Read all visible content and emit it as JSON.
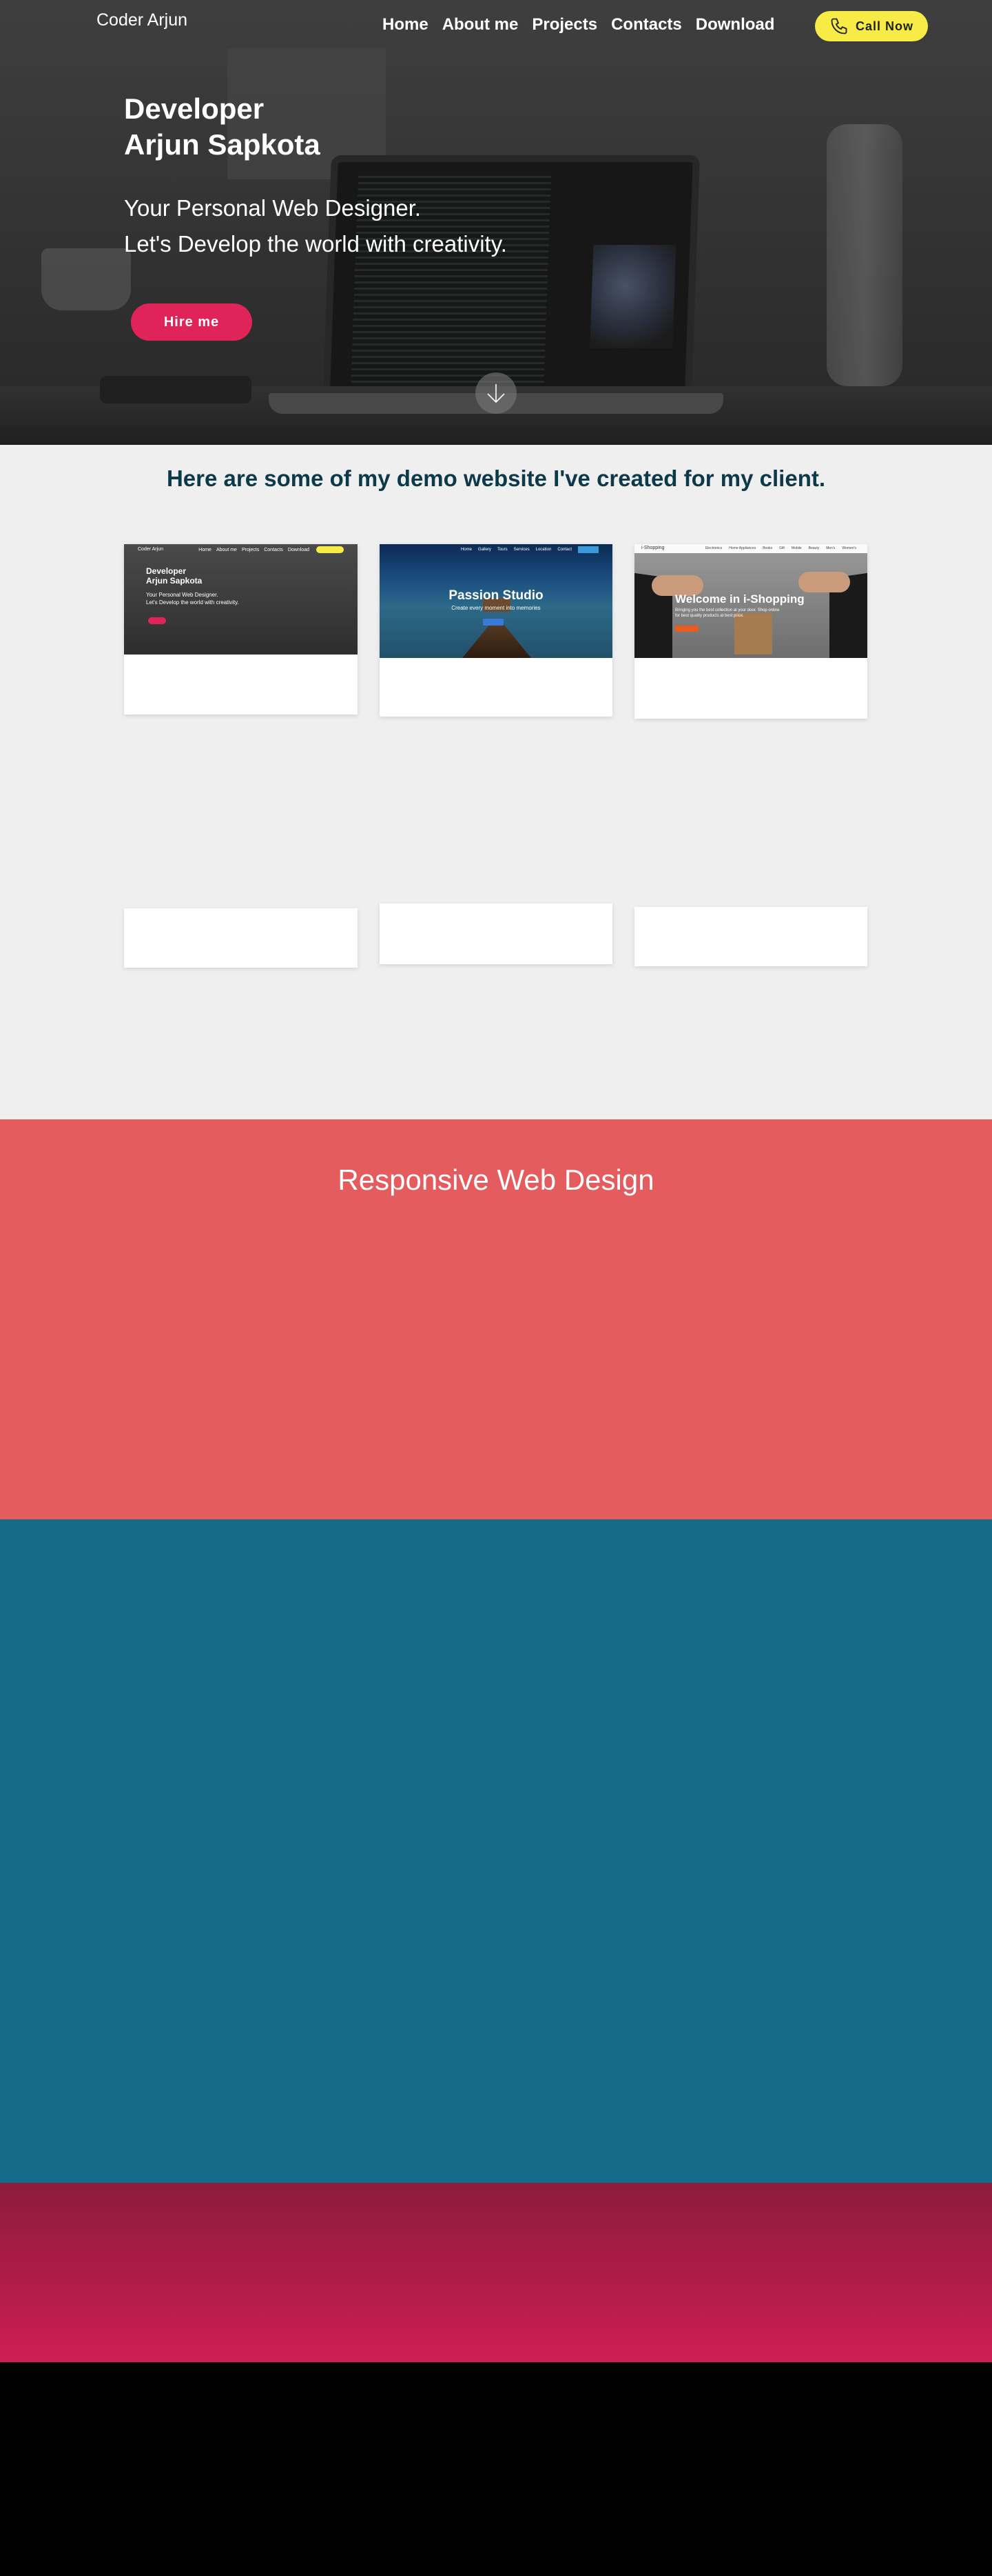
{
  "header": {
    "logo": "Coder Arjun",
    "nav": [
      "Home",
      "About me",
      "Projects",
      "Contacts",
      "Download"
    ],
    "call_button": "Call Now",
    "call_icon": "phone-icon"
  },
  "hero": {
    "title_line1": "Developer",
    "title_line2": "Arjun Sapkota",
    "subtitle_line1": "Your Personal Web Designer.",
    "subtitle_line2": "Let's Develop the world with creativity.",
    "hire_button": "Hire me",
    "scroll_icon": "arrow-down-icon"
  },
  "projects": {
    "heading": "Here are some of my demo website I've created for my client.",
    "cards": [
      {
        "logo": "Coder Arjun",
        "nav": [
          "Home",
          "About me",
          "Projects",
          "Contacts",
          "Download"
        ],
        "title_line1": "Developer",
        "title_line2": "Arjun Sapkota",
        "subtitle_line1": "Your Personal Web Designer.",
        "subtitle_line2": "Let's Develop the world with creativity.",
        "button": "Hire me"
      },
      {
        "nav": [
          "Home",
          "Gallery",
          "Tours",
          "Services",
          "Location",
          "Contact"
        ],
        "book_button": "Book Now",
        "title": "Passion Studio",
        "subtitle": "Create every moment into memories",
        "button": "Explore"
      },
      {
        "brand": "i-Shopping",
        "links": [
          "Electronics",
          "Home Appliances",
          "Books",
          "Gift",
          "Mobile",
          "Beauty",
          "Men's",
          "Women's"
        ],
        "title": "Welcome in i-Shopping",
        "subtitle": "Bringing you the best collection at your door. Shop online for best quality products at best price.",
        "button": "Shop Now"
      }
    ]
  },
  "responsive": {
    "heading": "Responsive Web Design"
  },
  "colors": {
    "accent_yellow": "#f6ec45",
    "accent_pink": "#e0245a",
    "heading_navy": "#0d3a4b",
    "coral": "#e45c5e",
    "teal": "#146b8a"
  }
}
